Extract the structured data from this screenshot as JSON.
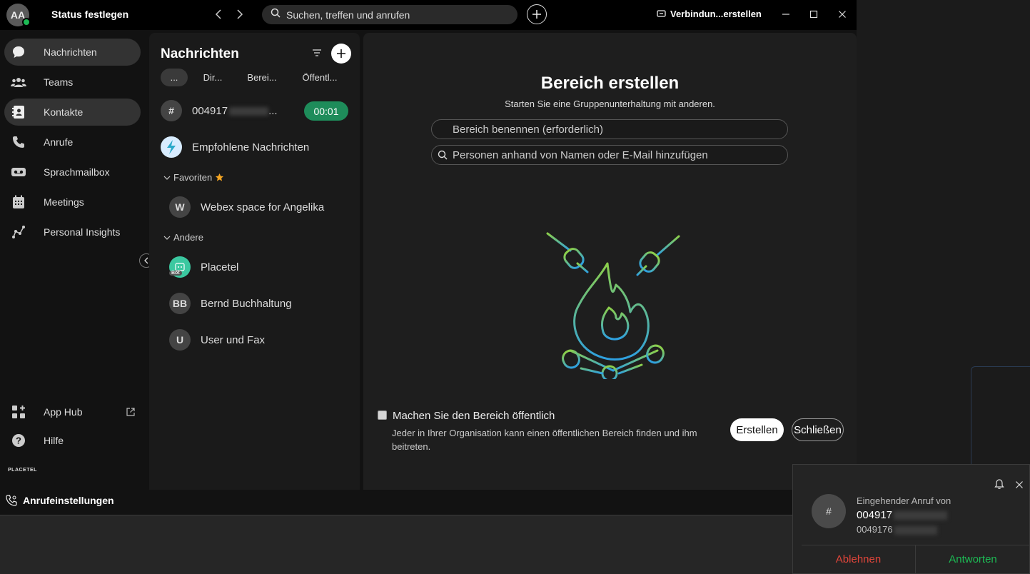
{
  "titlebar": {
    "avatar_initials": "AA",
    "status": "Status festlegen",
    "search_placeholder": "Suchen, treffen und anrufen",
    "connect": "Verbindun...erstellen"
  },
  "sidebar": {
    "items": [
      {
        "label": "Nachrichten",
        "icon": "chat-bubble-icon"
      },
      {
        "label": "Teams",
        "icon": "people-icon"
      },
      {
        "label": "Kontakte",
        "icon": "contacts-icon"
      },
      {
        "label": "Anrufe",
        "icon": "phone-icon"
      },
      {
        "label": "Sprachmailbox",
        "icon": "voicemail-icon"
      },
      {
        "label": "Meetings",
        "icon": "calendar-icon"
      },
      {
        "label": "Personal Insights",
        "icon": "insights-icon"
      }
    ],
    "app_hub": "App Hub",
    "help": "Hilfe",
    "logo": "PLACETEL",
    "call_settings": "Anrufeinstellungen"
  },
  "messages": {
    "title": "Nachrichten",
    "tabs": [
      "...",
      "Dir...",
      "Berei...",
      "Öffentl..."
    ],
    "active_call_number": "004917",
    "active_call_timer": "00:01",
    "recommended": "Empfohlene Nachrichten",
    "favorites_header": "Favoriten",
    "favorites": [
      {
        "initial": "W",
        "name": "Webex space for Angelika"
      }
    ],
    "others_header": "Andere",
    "others": [
      {
        "initial": "",
        "name": "Placetel",
        "badge": "Bot"
      },
      {
        "initial": "BB",
        "name": "Bernd Buchhaltung"
      },
      {
        "initial": "U",
        "name": "User und Fax"
      }
    ]
  },
  "create_space": {
    "title": "Bereich erstellen",
    "subtitle": "Starten Sie eine Gruppenunterhaltung mit anderen.",
    "name_placeholder": "Bereich benennen (erforderlich)",
    "people_placeholder": "Personen anhand von Namen oder E-Mail hinzufügen",
    "public_label": "Machen Sie den Bereich öffentlich",
    "public_desc": "Jeder in Ihrer Organisation kann einen öffentlichen Bereich finden und ihm beitreten.",
    "create_button": "Erstellen",
    "close_button": "Schließen"
  },
  "incoming_call": {
    "avatar": "#",
    "heading": "Eingehender Anruf von",
    "number": "004917",
    "number2": "0049176",
    "decline": "Ablehnen",
    "accept": "Antworten"
  },
  "colors": {
    "accent_green": "#1db954",
    "timer_green": "#1e8c5a",
    "decline_red": "#e0453a"
  }
}
